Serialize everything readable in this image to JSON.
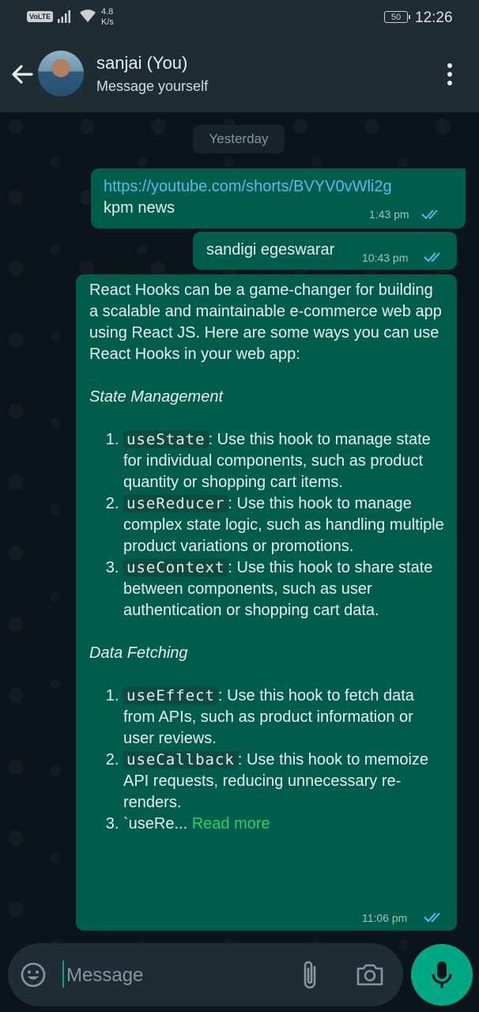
{
  "status_bar": {
    "volte": "VoLTE",
    "speed_value": "4.8",
    "speed_unit": "K/s",
    "battery": "50",
    "time": "12:26"
  },
  "header": {
    "contact_name": "sanjai (You)",
    "subtitle": "Message yourself"
  },
  "date_chip": "Yesterday",
  "messages": [
    {
      "link": "https://youtube.com/shorts/BVYV0vWli2g",
      "text": "kpm news",
      "time": "1:43 pm"
    },
    {
      "text": "sandigi egeswarar",
      "time": "10:43 pm"
    },
    {
      "intro": "React Hooks can be a game-changer for building a scalable and maintainable e-commerce web app using React JS. Here are some ways you can use React Hooks in your web app:",
      "section1": "State Management",
      "section1_items": [
        {
          "code": "useState",
          "text": ": Use this hook to manage state for individual components, such as product quantity or shopping cart items."
        },
        {
          "code": "useReducer",
          "text": ": Use this hook to manage complex state logic, such as handling multiple product variations or promotions."
        },
        {
          "code": "useContext",
          "text": ": Use this hook to share state between components, such as user authentication or shopping cart data."
        }
      ],
      "section2": "Data Fetching",
      "section2_items": [
        {
          "code": "useEffect",
          "text": ": Use this hook to fetch data from APIs, such as product information or user reviews."
        },
        {
          "code": "useCallback",
          "text": ": Use this hook to memoize API requests, reducing unnecessary re-renders."
        }
      ],
      "truncated": "`useRe... ",
      "read_more": "Read more",
      "time": "11:06 pm"
    }
  ],
  "input": {
    "placeholder": "Message"
  },
  "colors": {
    "header_bg": "#1f2c34",
    "chat_bg": "#0b141a",
    "outgoing_bubble": "#005c4b",
    "accent_green": "#00a884",
    "link_blue": "#53bdeb",
    "read_more_green": "#25d366"
  },
  "icons": [
    "back-arrow-icon",
    "more-options-icon",
    "double-check-icon",
    "emoji-icon",
    "attach-icon",
    "camera-icon",
    "mic-icon"
  ]
}
